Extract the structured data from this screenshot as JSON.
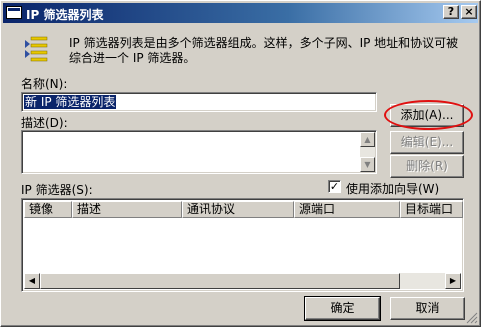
{
  "window": {
    "title": "IP 筛选器列表",
    "help_button": "?",
    "close_button": "×"
  },
  "description": "IP 筛选器列表是由多个筛选器组成。这样，多个子网、IP 地址和协议可被综合进一个 IP 筛选器。",
  "name_field": {
    "label": "名称(N):",
    "value": "新 IP 筛选器列表"
  },
  "desc_field": {
    "label": "描述(D):",
    "value": ""
  },
  "buttons": {
    "add": "添加(A)...",
    "edit": "编辑(E)...",
    "remove": "删除(R)",
    "ok": "确定",
    "cancel": "取消"
  },
  "filters": {
    "label": "IP 筛选器(S):",
    "use_wizard_label": "使用添加向导(W)",
    "use_wizard_checked": true,
    "columns": [
      "镜像",
      "描述",
      "通讯协议",
      "源端口",
      "目标端口"
    ],
    "rows": []
  },
  "icons": {
    "filter_list": "filter-list-icon",
    "scroll_up": "up-arrow-icon",
    "scroll_down": "down-arrow-icon",
    "scroll_left": "left-arrow-icon",
    "scroll_right": "right-arrow-icon",
    "checkmark": "checkmark-icon"
  },
  "colors": {
    "titlebar": "#0a246a",
    "highlight_oval": "#e01010"
  }
}
